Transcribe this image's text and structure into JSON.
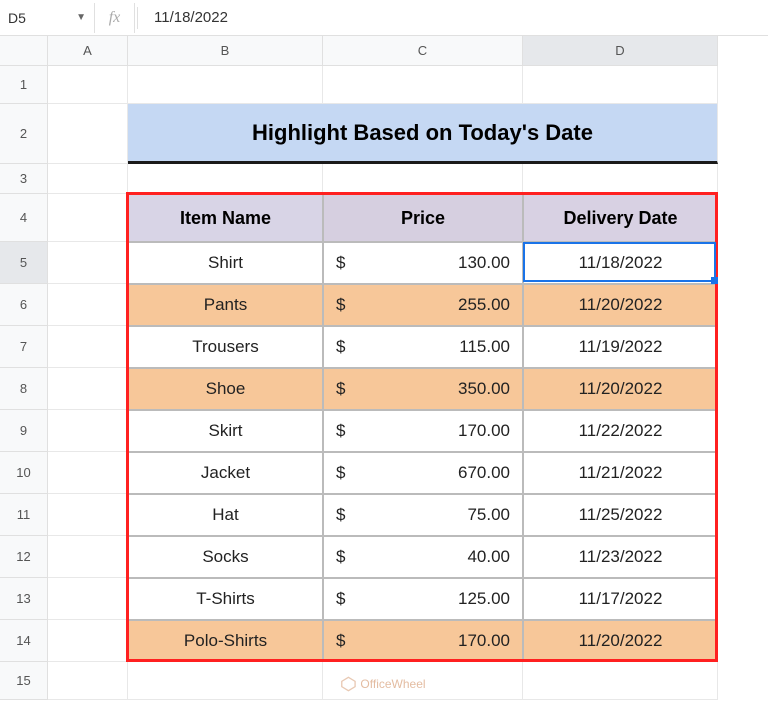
{
  "formulaBar": {
    "nameBox": "D5",
    "formula": "11/18/2022"
  },
  "columns": [
    "A",
    "B",
    "C",
    "D"
  ],
  "rows": [
    "1",
    "2",
    "3",
    "4",
    "5",
    "6",
    "7",
    "8",
    "9",
    "10",
    "11",
    "12",
    "13",
    "14",
    "15"
  ],
  "title": "Highlight Based on Today's Date",
  "headers": {
    "item": "Item Name",
    "price": "Price",
    "delivery": "Delivery Date"
  },
  "currency": "$",
  "data": [
    {
      "item": "Shirt",
      "price": "130.00",
      "date": "11/18/2022",
      "hl": false
    },
    {
      "item": "Pants",
      "price": "255.00",
      "date": "11/20/2022",
      "hl": true
    },
    {
      "item": "Trousers",
      "price": "115.00",
      "date": "11/19/2022",
      "hl": false
    },
    {
      "item": "Shoe",
      "price": "350.00",
      "date": "11/20/2022",
      "hl": true
    },
    {
      "item": "Skirt",
      "price": "170.00",
      "date": "11/22/2022",
      "hl": false
    },
    {
      "item": "Jacket",
      "price": "670.00",
      "date": "11/21/2022",
      "hl": false
    },
    {
      "item": "Hat",
      "price": "75.00",
      "date": "11/25/2022",
      "hl": false
    },
    {
      "item": "Socks",
      "price": "40.00",
      "date": "11/23/2022",
      "hl": false
    },
    {
      "item": "T-Shirts",
      "price": "125.00",
      "date": "11/17/2022",
      "hl": false
    },
    {
      "item": "Polo-Shirts",
      "price": "170.00",
      "date": "11/20/2022",
      "hl": true
    }
  ],
  "watermark": "OfficeWheel",
  "selectedCell": "D5",
  "selectedCol": "D",
  "selectedRow": "5"
}
